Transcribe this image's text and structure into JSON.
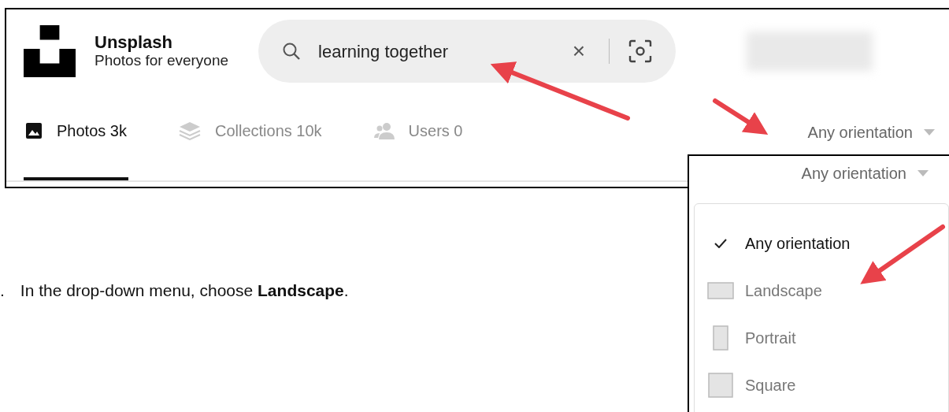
{
  "search_screen": {
    "logo": {
      "title": "Unsplash",
      "subtitle": "Photos for everyone"
    },
    "search": {
      "value": "learning together",
      "clear": "×"
    },
    "tabs": [
      {
        "label": "Photos 3k",
        "kind": "photos",
        "selected": true
      },
      {
        "label": "Collections 10k",
        "kind": "collections",
        "selected": false
      },
      {
        "label": "Users 0",
        "kind": "users",
        "selected": false
      }
    ],
    "orientation_filter": {
      "label": "Any orientation"
    }
  },
  "menu_screen": {
    "orientation_filter": {
      "label": "Any orientation"
    },
    "options": [
      {
        "label": "Any orientation",
        "checked": true
      },
      {
        "label": "Landscape",
        "kind": "landscape",
        "checked": false
      },
      {
        "label": "Portrait",
        "kind": "portrait",
        "checked": false
      },
      {
        "label": "Square",
        "kind": "square",
        "checked": false
      }
    ]
  },
  "instruction": {
    "number": ".",
    "text": "In the drop-down menu, choose **Landscape**."
  }
}
